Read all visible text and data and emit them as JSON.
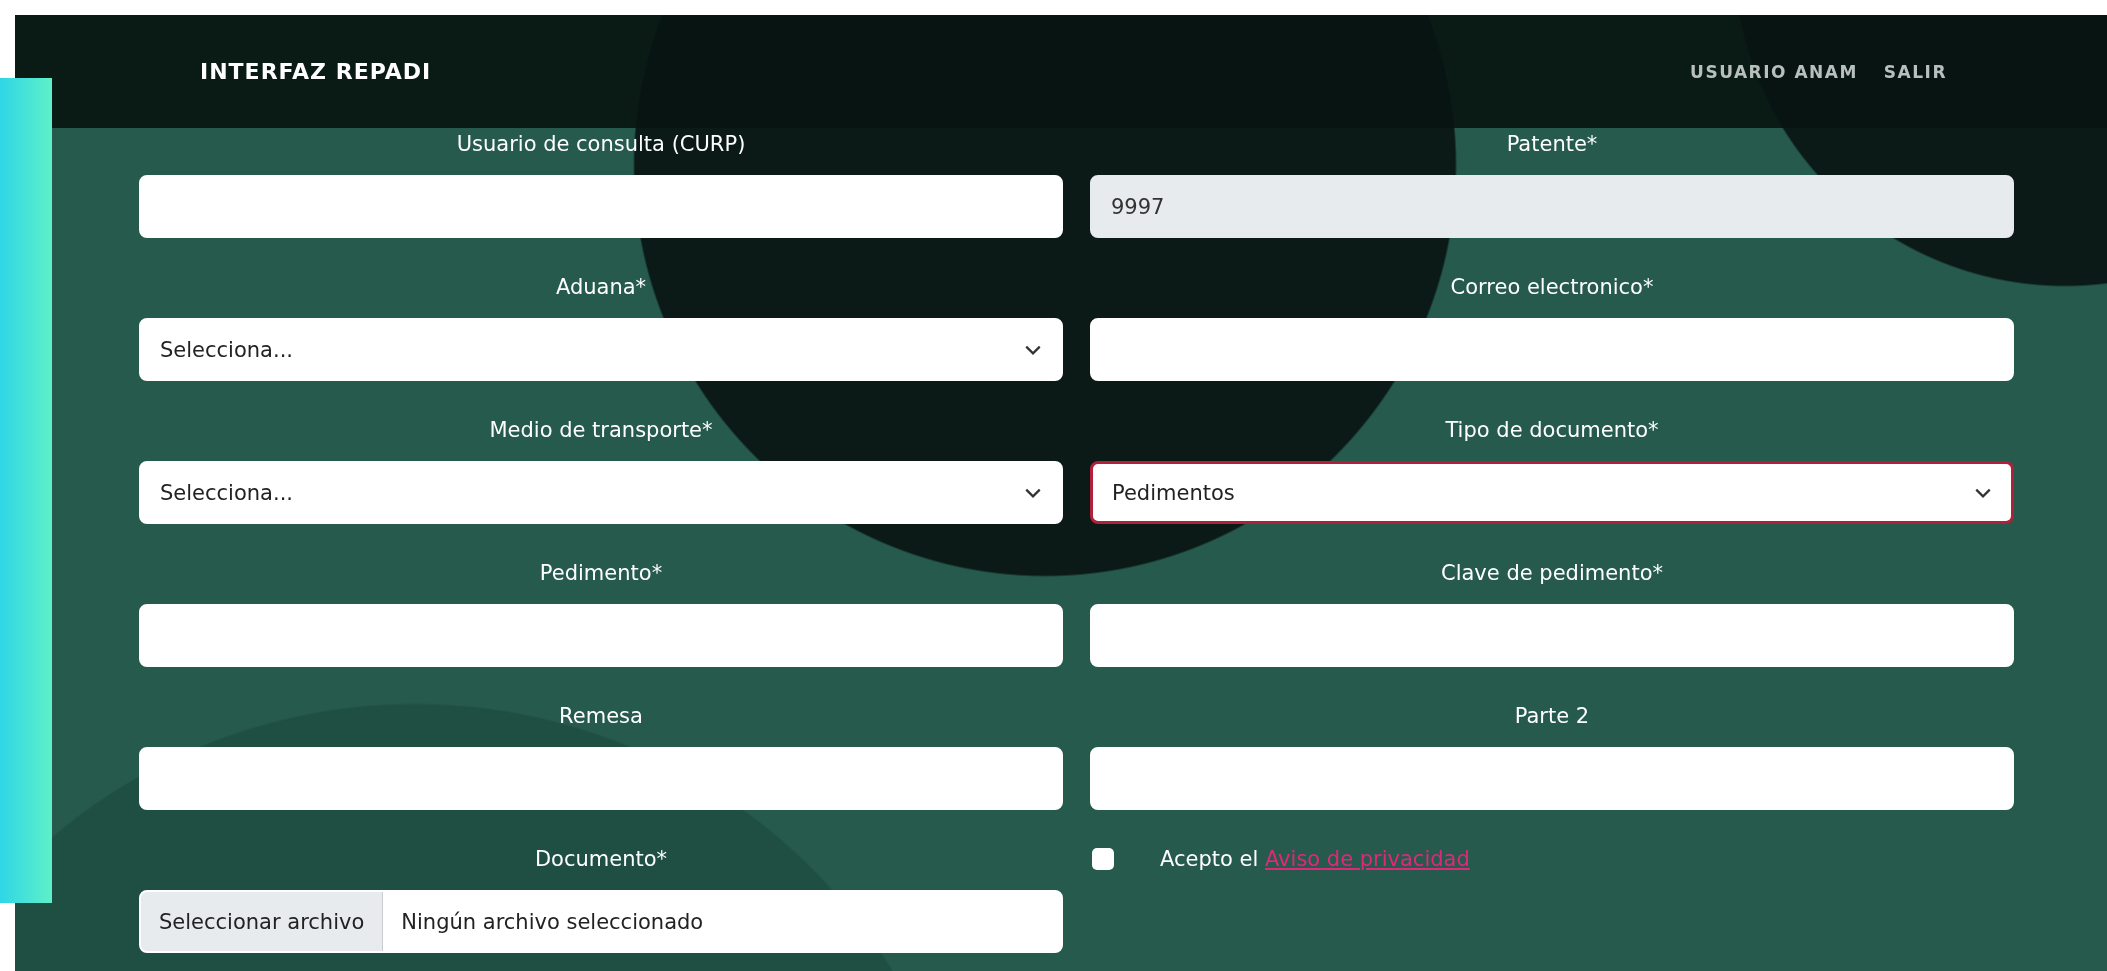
{
  "header": {
    "title": "INTERFAZ REPADI",
    "nav": [
      "USUARIO ANAM",
      "SALIR"
    ]
  },
  "form": {
    "fields": [
      {
        "kind": "text",
        "label": "Usuario de consulta (CURP)",
        "disabled": false,
        "focused": false
      },
      {
        "kind": "text",
        "label": "Patente*",
        "value": "9997",
        "disabled": true,
        "focused": false
      },
      {
        "kind": "select",
        "label": "Aduana*",
        "value": "Selecciona...",
        "disabled": false,
        "focused": false
      },
      {
        "kind": "text",
        "label": "Correo electronico*",
        "disabled": false,
        "focused": false
      },
      {
        "kind": "select",
        "label": "Medio de transporte*",
        "value": "Selecciona...",
        "disabled": false,
        "focused": false
      },
      {
        "kind": "select",
        "label": "Tipo de documento*",
        "value": "Pedimentos",
        "disabled": false,
        "focused": true
      },
      {
        "kind": "text",
        "label": "Pedimento*",
        "disabled": false,
        "focused": false
      },
      {
        "kind": "text",
        "label": "Clave de pedimento*",
        "disabled": false,
        "focused": false
      },
      {
        "kind": "text",
        "label": "Remesa",
        "disabled": false,
        "focused": false
      },
      {
        "kind": "text",
        "label": "Parte 2",
        "disabled": false,
        "focused": false
      },
      {
        "kind": "file",
        "label": "Documento*",
        "button": "Seleccionar archivo",
        "value": "Ningún archivo seleccionado"
      },
      {
        "kind": "checkbox",
        "text": "Acepto el",
        "link": "Aviso de privacidad",
        "checked": false
      }
    ]
  }
}
